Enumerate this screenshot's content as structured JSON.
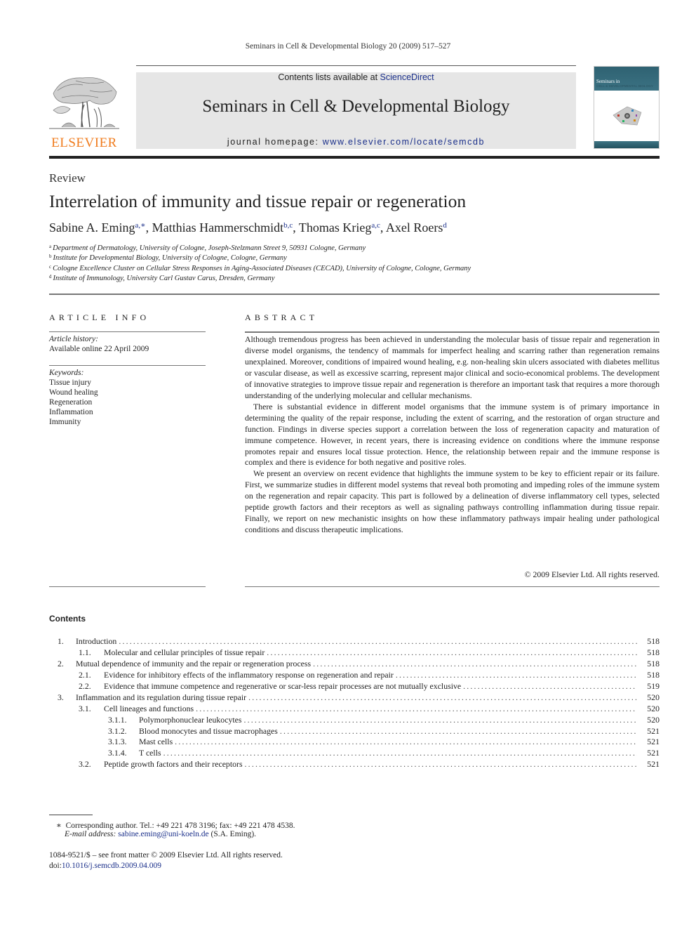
{
  "running_head": "Seminars in Cell & Developmental Biology 20 (2009) 517–527",
  "banner": {
    "contents_prefix": "Contents lists available at ",
    "contents_link": "ScienceDirect",
    "journal_title": "Seminars in Cell & Developmental Biology",
    "homepage_prefix": "journal homepage: ",
    "homepage_link": "www.elsevier.com/locate/semcdb"
  },
  "publisher": {
    "logo_word": "ELSEVIER",
    "logo_color": "#f07c1e"
  },
  "cover": {
    "series": "Seminars in",
    "title": "CELL & DEVELOPMENTAL BIOLOGY",
    "accent_color": "#2f6272"
  },
  "article": {
    "type": "Review",
    "title": "Interrelation of immunity and tissue repair or regeneration",
    "authors": [
      {
        "name": "Sabine A. Eming",
        "affil": "a,∗",
        "sep": ", "
      },
      {
        "name": "Matthias Hammerschmidt",
        "affil": "b,c",
        "sep": ", "
      },
      {
        "name": "Thomas Krieg",
        "affil": "a,c",
        "sep": ", "
      },
      {
        "name": "Axel Roers",
        "affil": "d",
        "sep": ""
      }
    ],
    "affiliations": [
      {
        "key": "a",
        "text": "Department of Dermatology, University of Cologne, Joseph-Stelzmann Street 9, 50931 Cologne, Germany"
      },
      {
        "key": "b",
        "text": "Institute for Developmental Biology, University of Cologne, Cologne, Germany"
      },
      {
        "key": "c",
        "text": "Cologne Excellence Cluster on Cellular Stress Responses in Aging-Associated Diseases (CECAD), University of Cologne, Cologne, Germany"
      },
      {
        "key": "d",
        "text": "Institute of Immunology, University Carl Gustav Carus, Dresden, Germany"
      }
    ]
  },
  "article_info": {
    "heading": "ARTICLE INFO",
    "history_label": "Article history:",
    "history_value": "Available online 22 April 2009",
    "keywords_label": "Keywords:",
    "keywords": [
      "Tissue injury",
      "Wound healing",
      "Regeneration",
      "Inflammation",
      "Immunity"
    ]
  },
  "abstract": {
    "heading": "ABSTRACT",
    "paragraphs": [
      "Although tremendous progress has been achieved in understanding the molecular basis of tissue repair and regeneration in diverse model organisms, the tendency of mammals for imperfect healing and scarring rather than regeneration remains unexplained. Moreover, conditions of impaired wound healing, e.g. non-healing skin ulcers associated with diabetes mellitus or vascular disease, as well as excessive scarring, represent major clinical and socio-economical problems. The development of innovative strategies to improve tissue repair and regeneration is therefore an important task that requires a more thorough understanding of the underlying molecular and cellular mechanisms.",
      "There is substantial evidence in different model organisms that the immune system is of primary importance in determining the quality of the repair response, including the extent of scarring, and the restoration of organ structure and function. Findings in diverse species support a correlation between the loss of regeneration capacity and maturation of immune competence. However, in recent years, there is increasing evidence on conditions where the immune response promotes repair and ensures local tissue protection. Hence, the relationship between repair and the immune response is complex and there is evidence for both negative and positive roles.",
      "We present an overview on recent evidence that highlights the immune system to be key to efficient repair or its failure. First, we summarize studies in different model systems that reveal both promoting and impeding roles of the immune system on the regeneration and repair capacity. This part is followed by a delineation of diverse inflammatory cell types, selected peptide growth factors and their receptors as well as signaling pathways controlling inflammation during tissue repair. Finally, we report on new mechanistic insights on how these inflammatory pathways impair healing under pathological conditions and discuss therapeutic implications."
    ],
    "copyright": "© 2009 Elsevier Ltd. All rights reserved."
  },
  "contents": {
    "heading": "Contents",
    "entries": [
      {
        "num": "1.",
        "title": "Introduction",
        "page": "518",
        "level": 1
      },
      {
        "num": "1.1.",
        "title": "Molecular and cellular principles of tissue repair",
        "page": "518",
        "level": 2
      },
      {
        "num": "2.",
        "title": "Mutual dependence of immunity and the repair or regeneration process",
        "page": "518",
        "level": 1
      },
      {
        "num": "2.1.",
        "title": "Evidence for inhibitory effects of the inflammatory response on regeneration and repair",
        "page": "518",
        "level": 2
      },
      {
        "num": "2.2.",
        "title": "Evidence that immune competence and regenerative or scar-less repair processes are not mutually exclusive",
        "page": "519",
        "level": 2
      },
      {
        "num": "3.",
        "title": "Inflammation and its regulation during tissue repair",
        "page": "520",
        "level": 1
      },
      {
        "num": "3.1.",
        "title": "Cell lineages and functions",
        "page": "520",
        "level": 2
      },
      {
        "num": "3.1.1.",
        "title": "Polymorphonuclear leukocytes",
        "page": "520",
        "level": 3
      },
      {
        "num": "3.1.2.",
        "title": "Blood monocytes and tissue macrophages",
        "page": "521",
        "level": 3
      },
      {
        "num": "3.1.3.",
        "title": "Mast cells",
        "page": "521",
        "level": 3
      },
      {
        "num": "3.1.4.",
        "title": "T cells",
        "page": "521",
        "level": 3
      },
      {
        "num": "3.2.",
        "title": "Peptide growth factors and their receptors",
        "page": "521",
        "level": 2
      }
    ]
  },
  "footnotes": {
    "corresponding_mark": "∗",
    "corresponding": "Corresponding author. Tel.: +49 221 478 3196; fax: +49 221 478 4538.",
    "email_label": "E-mail address:",
    "email": "sabine.eming@uni-koeln.de",
    "email_suffix": " (S.A. Eming).",
    "front_matter": "1084-9521/$ – see front matter © 2009 Elsevier Ltd. All rights reserved.",
    "doi_prefix": "doi:",
    "doi": "10.1016/j.semcdb.2009.04.009"
  }
}
